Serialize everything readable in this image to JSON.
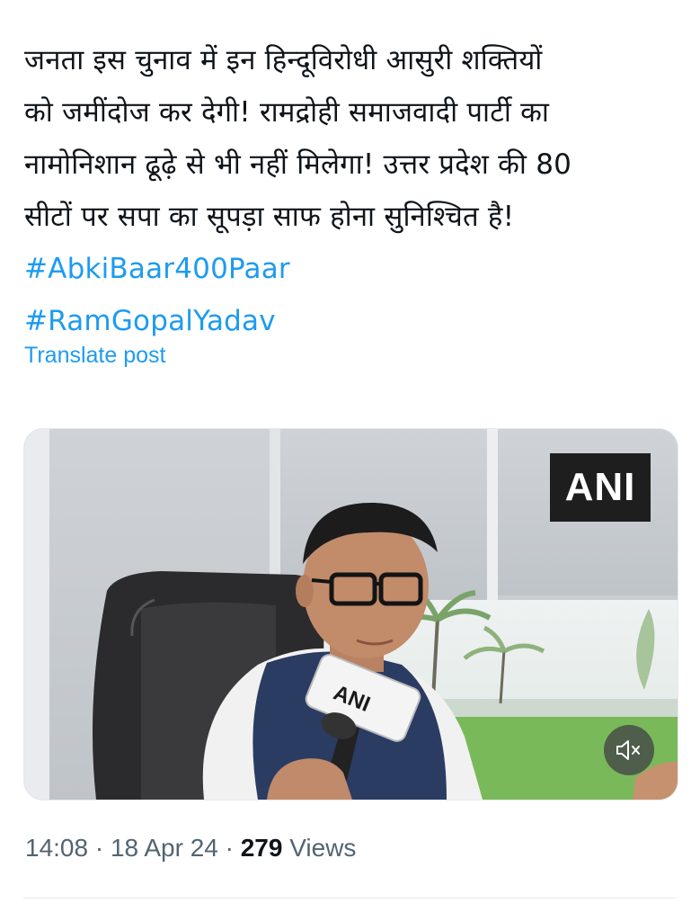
{
  "post": {
    "lines": [
      "जनता इस चुनाव में इन हिन्दूविरोधी आसुरी शक्तियों",
      "को जमींदोज कर देगी! रामद्रोही समाजवादी पार्टी का",
      "नामोनिशान ढूढ़े से भी नहीं मिलेगा! उत्तर प्रदेश की 80",
      "सीटों पर सपा का सूपड़ा साफ होना सुनिश्चित है!"
    ],
    "hashtags": [
      "#AbkiBaar400Paar",
      "#RamGopalYadav"
    ],
    "translate_label": "Translate post"
  },
  "media": {
    "watermark": "ANI",
    "mic_label": "ANI",
    "mute_icon": "speaker-muted-icon"
  },
  "meta": {
    "time": "14:08",
    "separator": "·",
    "date": "18 Apr 24",
    "views_count": "279",
    "views_label": "Views"
  },
  "colors": {
    "text": "#0f1419",
    "link": "#1d9bf0",
    "secondary": "#536471",
    "divider": "#e6e9ec"
  }
}
